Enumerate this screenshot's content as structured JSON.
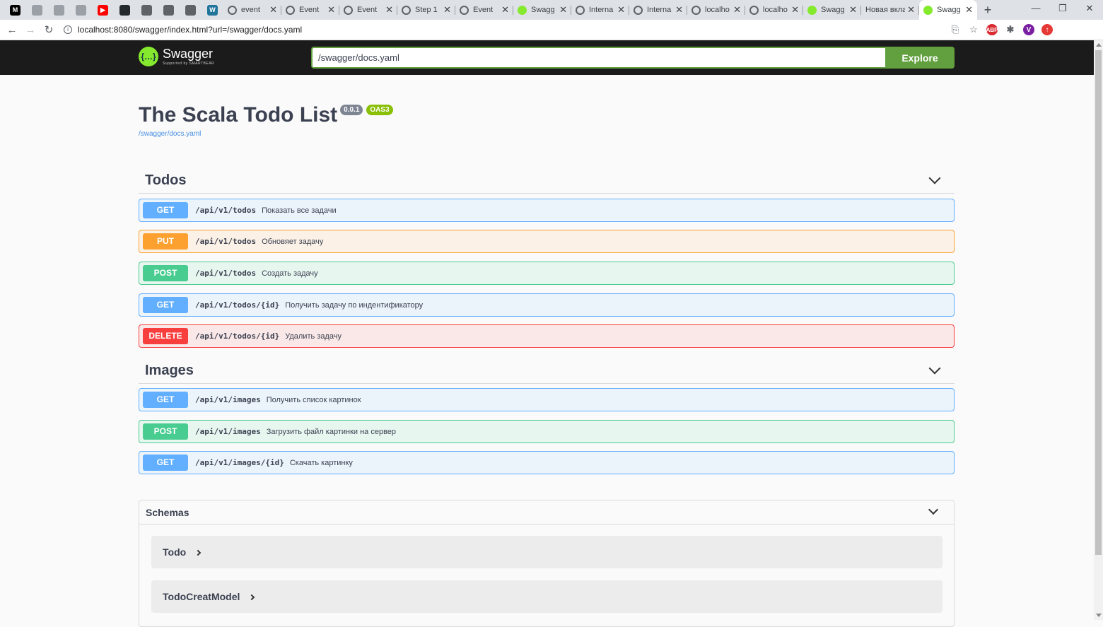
{
  "browser": {
    "pinned_tabs": [
      {
        "icon": "medium-icon",
        "glyph": "M",
        "color": "#000000"
      },
      {
        "icon": "page-icon",
        "glyph": "",
        "color": "#9aa0a6"
      },
      {
        "icon": "page-icon",
        "glyph": "",
        "color": "#9aa0a6"
      },
      {
        "icon": "page-icon",
        "glyph": "",
        "color": "#9aa0a6"
      },
      {
        "icon": "youtube-icon",
        "glyph": "▶",
        "color": "#ff0000"
      },
      {
        "icon": "github-icon",
        "glyph": "",
        "color": "#24292e"
      },
      {
        "icon": "globe-icon",
        "glyph": "",
        "color": "#5f6368"
      },
      {
        "icon": "calculator-icon",
        "glyph": "",
        "color": "#5f6368"
      },
      {
        "icon": "image-icon",
        "glyph": "",
        "color": "#5f6368"
      },
      {
        "icon": "wordpress-icon",
        "glyph": "W",
        "color": "#21759b"
      }
    ],
    "tabs": [
      {
        "title": "event",
        "icon": "google-icon"
      },
      {
        "title": "Event",
        "icon": "globe-icon"
      },
      {
        "title": "Event",
        "icon": "dev-icon"
      },
      {
        "title": "Step 1",
        "icon": "circle-icon"
      },
      {
        "title": "Event",
        "icon": "circle-icon"
      },
      {
        "title": "Swagg",
        "icon": "swagger-icon"
      },
      {
        "title": "Interna",
        "icon": "globe-icon"
      },
      {
        "title": "Interna",
        "icon": "globe-icon"
      },
      {
        "title": "localho",
        "icon": "globe-icon"
      },
      {
        "title": "localho",
        "icon": "globe-icon"
      },
      {
        "title": "Swagg",
        "icon": "swagger-icon"
      },
      {
        "title": "Новая вкла",
        "icon": ""
      },
      {
        "title": "Swagg",
        "icon": "swagger-icon",
        "active": true
      }
    ],
    "url": "localhost:8080/swagger/index.html?url=/swagger/docs.yaml",
    "profile_initial": "V"
  },
  "topbar": {
    "logo_name": "Swagger",
    "logo_sub": "Supported by SMARTBEAR",
    "search_value": "/swagger/docs.yaml",
    "explore_label": "Explore"
  },
  "info": {
    "title": "The Scala Todo List",
    "version": "0.0.1",
    "oas": "OAS3",
    "spec_link": "/swagger/docs.yaml"
  },
  "tags": [
    {
      "name": "Todos",
      "operations": [
        {
          "method": "GET",
          "path": "/api/v1/todos",
          "summary": "Показать все задачи"
        },
        {
          "method": "PUT",
          "path": "/api/v1/todos",
          "summary": "Обновяет задачу"
        },
        {
          "method": "POST",
          "path": "/api/v1/todos",
          "summary": "Создать задачу"
        },
        {
          "method": "GET",
          "path": "/api/v1/todos/{id}",
          "summary": "Получить задачу по индентификатору"
        },
        {
          "method": "DELETE",
          "path": "/api/v1/todos/{id}",
          "summary": "Удалить задачу"
        }
      ]
    },
    {
      "name": "Images",
      "operations": [
        {
          "method": "GET",
          "path": "/api/v1/images",
          "summary": "Получить список картинок"
        },
        {
          "method": "POST",
          "path": "/api/v1/images",
          "summary": "Загрузить файл картинки на сервер"
        },
        {
          "method": "GET",
          "path": "/api/v1/images/{id}",
          "summary": "Скачать картинку"
        }
      ]
    }
  ],
  "schemas": {
    "title": "Schemas",
    "models": [
      "Todo",
      "TodoCreatModel"
    ]
  },
  "colors": {
    "get": "#61affe",
    "put": "#fca130",
    "post": "#49cc90",
    "delete": "#f93e3e",
    "accent": "#62a03f"
  }
}
